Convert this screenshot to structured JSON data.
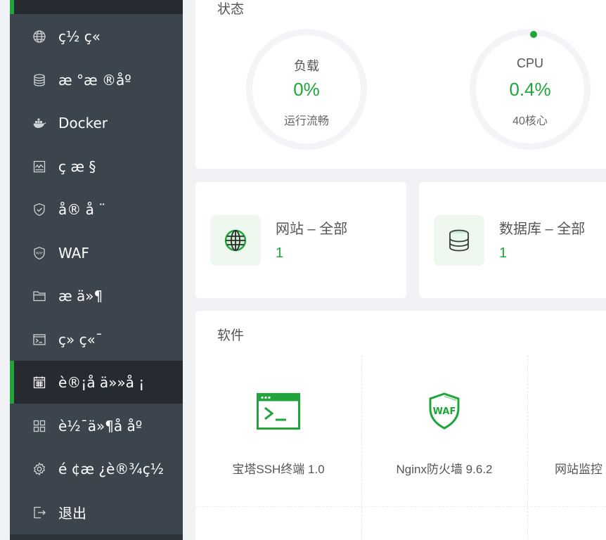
{
  "sidebar": {
    "items": [
      {
        "label": "",
        "icon": "home-icon",
        "active": true
      },
      {
        "label": "ç½ ç«",
        "icon": "globe-icon"
      },
      {
        "label": "æ °æ ®åº",
        "icon": "database-icon"
      },
      {
        "label": "Docker",
        "icon": "docker-icon"
      },
      {
        "label": "ç  æ §",
        "icon": "monitor-icon"
      },
      {
        "label": "å® å ¨",
        "icon": "shield-icon"
      },
      {
        "label": "WAF",
        "icon": "waf-icon"
      },
      {
        "label": "æ  ä»¶",
        "icon": "folder-icon"
      },
      {
        "label": "ç» ç«¯",
        "icon": "terminal-icon"
      },
      {
        "label": "è®¡å  ä»»å ¡",
        "icon": "calendar-icon",
        "active": true
      },
      {
        "label": "è½¯ä»¶å  åº",
        "icon": "apps-icon"
      },
      {
        "label": "é ¢æ ¿è®¾ç½",
        "icon": "settings-icon"
      },
      {
        "label": "退出",
        "icon": "logout-icon"
      }
    ]
  },
  "status": {
    "title": "状态",
    "load": {
      "label": "负载",
      "value": "0%",
      "sub": "运行流畅"
    },
    "cpu": {
      "label": "CPU",
      "value": "0.4%",
      "sub": "40核心"
    }
  },
  "stats": {
    "website": {
      "title": "网站 – 全部",
      "value": "1",
      "icon": "globe-icon"
    },
    "database": {
      "title": "数据库 – 全部",
      "value": "1",
      "icon": "database-icon"
    }
  },
  "software": {
    "title": "软件",
    "items": [
      {
        "name": "宝塔SSH终端 1.0",
        "icon": "terminal-icon"
      },
      {
        "name": "Nginx防火墙 9.6.2",
        "icon": "waf-icon",
        "icon_text": "WAF"
      },
      {
        "name": "网站监控",
        "icon": "monitor-icon"
      }
    ]
  },
  "colors": {
    "accent": "#20a53a",
    "sidebar": "#3c444d",
    "sidebar_active": "#262b31"
  }
}
